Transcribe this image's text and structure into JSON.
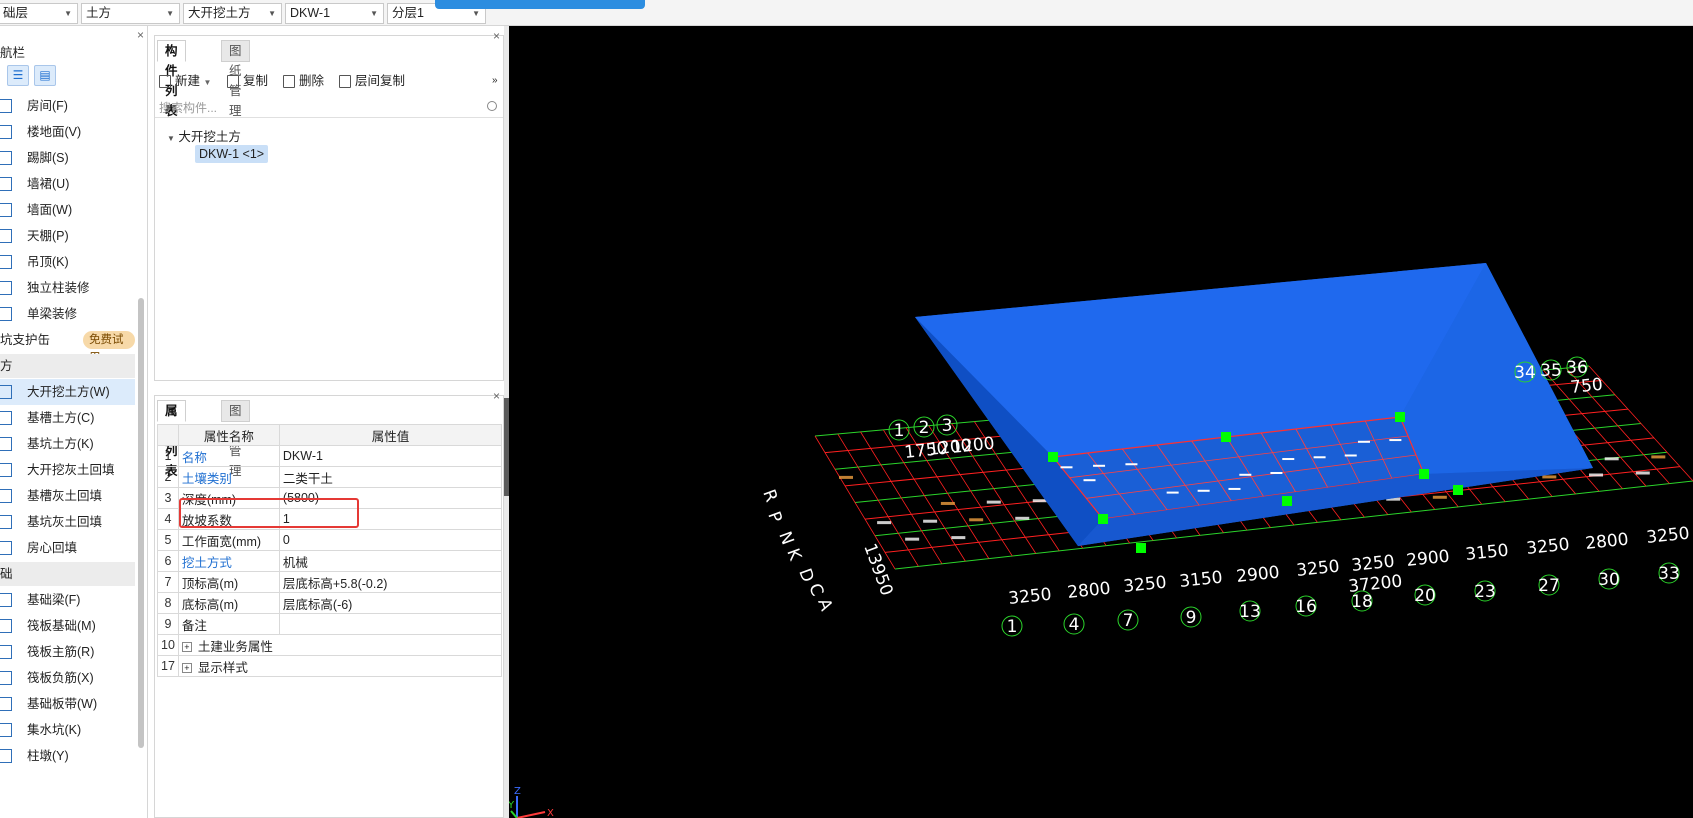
{
  "topbar": {
    "floor": "础层",
    "category": "土方",
    "component_type": "大开挖土方",
    "component_name": "DKW-1",
    "sublayer": "分层1"
  },
  "leftnav": {
    "title": "航栏",
    "items": [
      {
        "label": "房间(F)"
      },
      {
        "label": "楼地面(V)"
      },
      {
        "label": "踢脚(S)"
      },
      {
        "label": "墙裙(U)"
      },
      {
        "label": "墙面(W)"
      },
      {
        "label": "天棚(P)"
      },
      {
        "label": "吊顶(K)"
      },
      {
        "label": "独立柱装修"
      },
      {
        "label": "单梁装修"
      }
    ],
    "pit_support": {
      "label": "坑支护缶",
      "badge": "免费试用"
    },
    "section_earthwork": "方",
    "earthwork_items": [
      {
        "label": "大开挖土方(W)"
      },
      {
        "label": "基槽土方(C)"
      },
      {
        "label": "基坑土方(K)"
      },
      {
        "label": "大开挖灰土回填"
      },
      {
        "label": "基槽灰土回填"
      },
      {
        "label": "基坑灰土回填"
      },
      {
        "label": "房心回填"
      }
    ],
    "section_foundation": "础",
    "foundation_items": [
      {
        "label": "基础梁(F)"
      },
      {
        "label": "筏板基础(M)"
      },
      {
        "label": "筏板主筋(R)"
      },
      {
        "label": "筏板负筋(X)"
      },
      {
        "label": "基础板带(W)"
      },
      {
        "label": "集水坑(K)"
      },
      {
        "label": "柱墩(Y)"
      }
    ]
  },
  "complist": {
    "tab_active": "构件列表",
    "tab_other": "图纸管理",
    "toolbar": {
      "new": "新建",
      "copy": "复制",
      "delete": "删除",
      "floor_copy": "层间复制"
    },
    "search_placeholder": "搜索构件...",
    "tree_root": "大开挖土方",
    "tree_child": "DKW-1 <1>"
  },
  "proplist": {
    "tab_active": "属性列表",
    "tab_other": "图层管理",
    "col_name": "属性名称",
    "col_value": "属性值",
    "rows": [
      {
        "num": "1",
        "name": "名称",
        "value": "DKW-1"
      },
      {
        "num": "2",
        "name": "土壤类别",
        "value": "二类干土"
      },
      {
        "num": "3",
        "name": "深度(mm)",
        "value": "(5800)"
      },
      {
        "num": "4",
        "name": "放坡系数",
        "value": "1"
      },
      {
        "num": "5",
        "name": "工作面宽(mm)",
        "value": "0"
      },
      {
        "num": "6",
        "name": "挖土方式",
        "value": "机械"
      },
      {
        "num": "7",
        "name": "顶标高(m)",
        "value": "层底标高+5.8(-0.2)"
      },
      {
        "num": "8",
        "name": "底标高(m)",
        "value": "层底标高(-6)"
      },
      {
        "num": "9",
        "name": "备注",
        "value": ""
      },
      {
        "num": "10",
        "name": "土建业务属性",
        "value": ""
      },
      {
        "num": "17",
        "name": "显示样式",
        "value": ""
      }
    ]
  },
  "viewport": {
    "axis_numbers_bottom": [
      "1",
      "4",
      "7",
      "9",
      "13",
      "16",
      "18",
      "20",
      "23",
      "27",
      "30",
      "33"
    ],
    "axis_numbers_top": [
      "1",
      "2",
      "3",
      "34",
      "35",
      "36"
    ],
    "dims_bottom": [
      "3250",
      "2800",
      "3250",
      "3150",
      "2900",
      "3250",
      "3250",
      "2900",
      "3150",
      "3250",
      "2800",
      "3250"
    ],
    "dims_top": [
      "1750",
      "1200",
      "1200",
      "750"
    ],
    "total_length": "37200",
    "side_dim": "13950",
    "row_letters": [
      "R",
      "P",
      "N",
      "K",
      "D",
      "C",
      "A"
    ],
    "colors": {
      "pit": "#1565e6",
      "pit_side": "#0d47b8",
      "grid_red": "#ff2020",
      "grid_green": "#2bd42b",
      "marker": "#00ff00"
    }
  }
}
